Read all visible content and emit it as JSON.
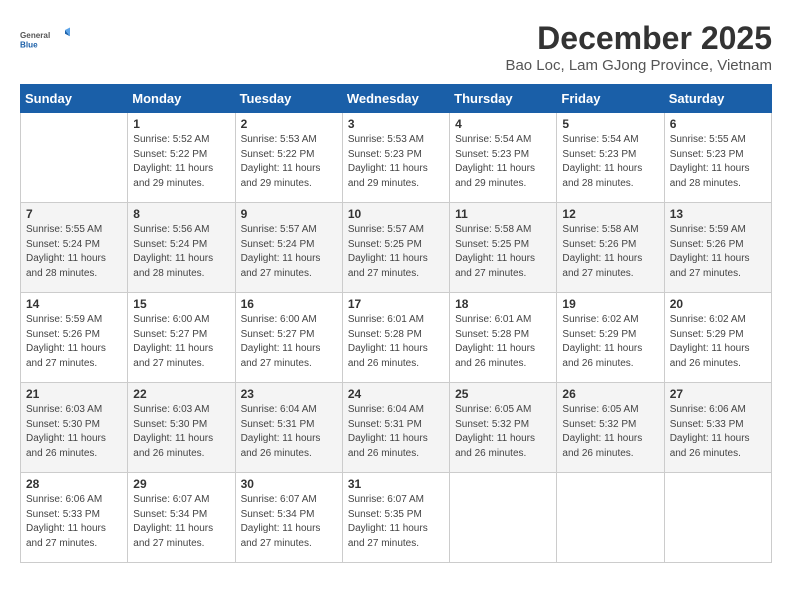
{
  "logo": {
    "general": "General",
    "blue": "Blue"
  },
  "title": "December 2025",
  "subtitle": "Bao Loc, Lam GJong Province, Vietnam",
  "days_header": [
    "Sunday",
    "Monday",
    "Tuesday",
    "Wednesday",
    "Thursday",
    "Friday",
    "Saturday"
  ],
  "weeks": [
    [
      {
        "num": "",
        "sunrise": "",
        "sunset": "",
        "daylight": ""
      },
      {
        "num": "1",
        "sunrise": "Sunrise: 5:52 AM",
        "sunset": "Sunset: 5:22 PM",
        "daylight": "Daylight: 11 hours and 29 minutes."
      },
      {
        "num": "2",
        "sunrise": "Sunrise: 5:53 AM",
        "sunset": "Sunset: 5:22 PM",
        "daylight": "Daylight: 11 hours and 29 minutes."
      },
      {
        "num": "3",
        "sunrise": "Sunrise: 5:53 AM",
        "sunset": "Sunset: 5:23 PM",
        "daylight": "Daylight: 11 hours and 29 minutes."
      },
      {
        "num": "4",
        "sunrise": "Sunrise: 5:54 AM",
        "sunset": "Sunset: 5:23 PM",
        "daylight": "Daylight: 11 hours and 29 minutes."
      },
      {
        "num": "5",
        "sunrise": "Sunrise: 5:54 AM",
        "sunset": "Sunset: 5:23 PM",
        "daylight": "Daylight: 11 hours and 28 minutes."
      },
      {
        "num": "6",
        "sunrise": "Sunrise: 5:55 AM",
        "sunset": "Sunset: 5:23 PM",
        "daylight": "Daylight: 11 hours and 28 minutes."
      }
    ],
    [
      {
        "num": "7",
        "sunrise": "Sunrise: 5:55 AM",
        "sunset": "Sunset: 5:24 PM",
        "daylight": "Daylight: 11 hours and 28 minutes."
      },
      {
        "num": "8",
        "sunrise": "Sunrise: 5:56 AM",
        "sunset": "Sunset: 5:24 PM",
        "daylight": "Daylight: 11 hours and 28 minutes."
      },
      {
        "num": "9",
        "sunrise": "Sunrise: 5:57 AM",
        "sunset": "Sunset: 5:24 PM",
        "daylight": "Daylight: 11 hours and 27 minutes."
      },
      {
        "num": "10",
        "sunrise": "Sunrise: 5:57 AM",
        "sunset": "Sunset: 5:25 PM",
        "daylight": "Daylight: 11 hours and 27 minutes."
      },
      {
        "num": "11",
        "sunrise": "Sunrise: 5:58 AM",
        "sunset": "Sunset: 5:25 PM",
        "daylight": "Daylight: 11 hours and 27 minutes."
      },
      {
        "num": "12",
        "sunrise": "Sunrise: 5:58 AM",
        "sunset": "Sunset: 5:26 PM",
        "daylight": "Daylight: 11 hours and 27 minutes."
      },
      {
        "num": "13",
        "sunrise": "Sunrise: 5:59 AM",
        "sunset": "Sunset: 5:26 PM",
        "daylight": "Daylight: 11 hours and 27 minutes."
      }
    ],
    [
      {
        "num": "14",
        "sunrise": "Sunrise: 5:59 AM",
        "sunset": "Sunset: 5:26 PM",
        "daylight": "Daylight: 11 hours and 27 minutes."
      },
      {
        "num": "15",
        "sunrise": "Sunrise: 6:00 AM",
        "sunset": "Sunset: 5:27 PM",
        "daylight": "Daylight: 11 hours and 27 minutes."
      },
      {
        "num": "16",
        "sunrise": "Sunrise: 6:00 AM",
        "sunset": "Sunset: 5:27 PM",
        "daylight": "Daylight: 11 hours and 27 minutes."
      },
      {
        "num": "17",
        "sunrise": "Sunrise: 6:01 AM",
        "sunset": "Sunset: 5:28 PM",
        "daylight": "Daylight: 11 hours and 26 minutes."
      },
      {
        "num": "18",
        "sunrise": "Sunrise: 6:01 AM",
        "sunset": "Sunset: 5:28 PM",
        "daylight": "Daylight: 11 hours and 26 minutes."
      },
      {
        "num": "19",
        "sunrise": "Sunrise: 6:02 AM",
        "sunset": "Sunset: 5:29 PM",
        "daylight": "Daylight: 11 hours and 26 minutes."
      },
      {
        "num": "20",
        "sunrise": "Sunrise: 6:02 AM",
        "sunset": "Sunset: 5:29 PM",
        "daylight": "Daylight: 11 hours and 26 minutes."
      }
    ],
    [
      {
        "num": "21",
        "sunrise": "Sunrise: 6:03 AM",
        "sunset": "Sunset: 5:30 PM",
        "daylight": "Daylight: 11 hours and 26 minutes."
      },
      {
        "num": "22",
        "sunrise": "Sunrise: 6:03 AM",
        "sunset": "Sunset: 5:30 PM",
        "daylight": "Daylight: 11 hours and 26 minutes."
      },
      {
        "num": "23",
        "sunrise": "Sunrise: 6:04 AM",
        "sunset": "Sunset: 5:31 PM",
        "daylight": "Daylight: 11 hours and 26 minutes."
      },
      {
        "num": "24",
        "sunrise": "Sunrise: 6:04 AM",
        "sunset": "Sunset: 5:31 PM",
        "daylight": "Daylight: 11 hours and 26 minutes."
      },
      {
        "num": "25",
        "sunrise": "Sunrise: 6:05 AM",
        "sunset": "Sunset: 5:32 PM",
        "daylight": "Daylight: 11 hours and 26 minutes."
      },
      {
        "num": "26",
        "sunrise": "Sunrise: 6:05 AM",
        "sunset": "Sunset: 5:32 PM",
        "daylight": "Daylight: 11 hours and 26 minutes."
      },
      {
        "num": "27",
        "sunrise": "Sunrise: 6:06 AM",
        "sunset": "Sunset: 5:33 PM",
        "daylight": "Daylight: 11 hours and 26 minutes."
      }
    ],
    [
      {
        "num": "28",
        "sunrise": "Sunrise: 6:06 AM",
        "sunset": "Sunset: 5:33 PM",
        "daylight": "Daylight: 11 hours and 27 minutes."
      },
      {
        "num": "29",
        "sunrise": "Sunrise: 6:07 AM",
        "sunset": "Sunset: 5:34 PM",
        "daylight": "Daylight: 11 hours and 27 minutes."
      },
      {
        "num": "30",
        "sunrise": "Sunrise: 6:07 AM",
        "sunset": "Sunset: 5:34 PM",
        "daylight": "Daylight: 11 hours and 27 minutes."
      },
      {
        "num": "31",
        "sunrise": "Sunrise: 6:07 AM",
        "sunset": "Sunset: 5:35 PM",
        "daylight": "Daylight: 11 hours and 27 minutes."
      },
      {
        "num": "",
        "sunrise": "",
        "sunset": "",
        "daylight": ""
      },
      {
        "num": "",
        "sunrise": "",
        "sunset": "",
        "daylight": ""
      },
      {
        "num": "",
        "sunrise": "",
        "sunset": "",
        "daylight": ""
      }
    ]
  ]
}
